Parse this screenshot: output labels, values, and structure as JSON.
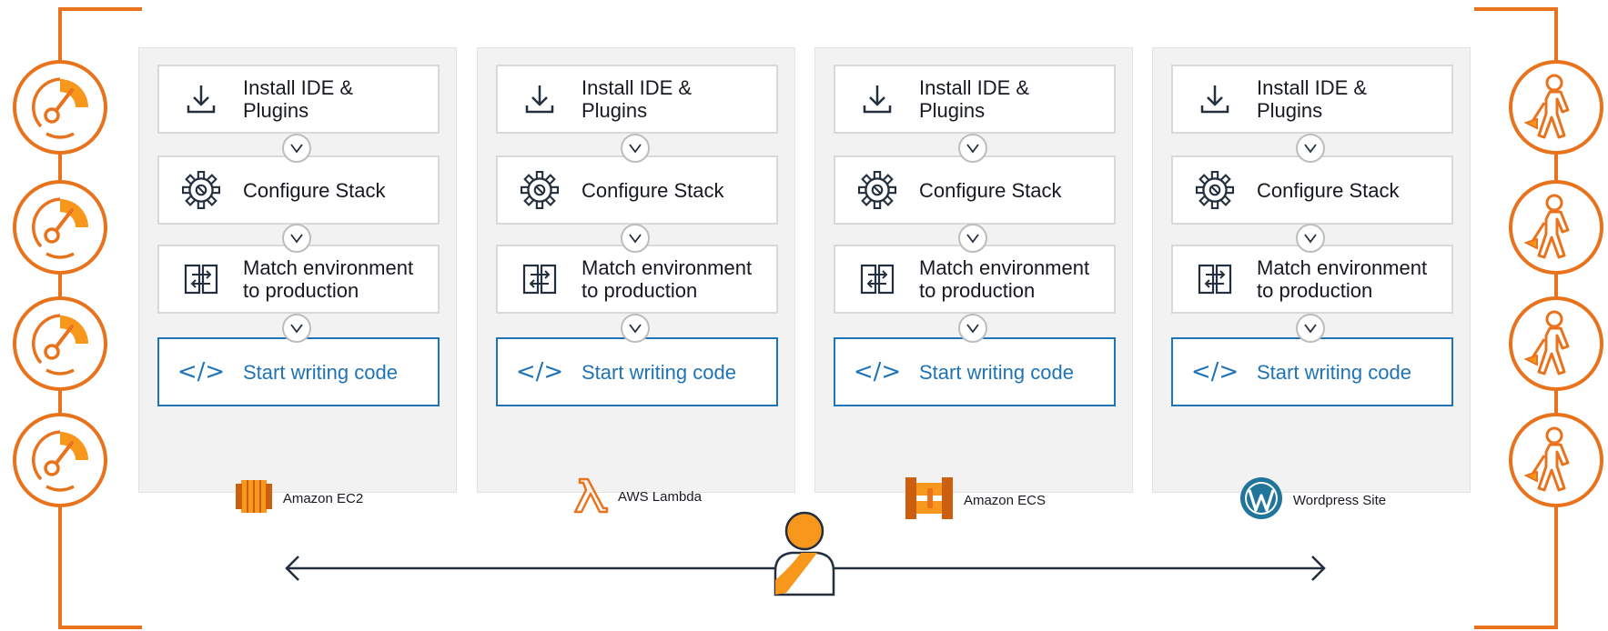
{
  "columns": [
    {
      "steps": [
        {
          "label_lines": [
            "Install IDE &",
            "Plugins"
          ]
        },
        {
          "label_lines": [
            "Configure Stack"
          ]
        },
        {
          "label_lines": [
            "Match environment",
            "to production"
          ]
        },
        {
          "label_lines": [
            "Start writing code"
          ]
        }
      ],
      "service": {
        "label": "Amazon EC2",
        "icon": "amazon-ec2-icon"
      }
    },
    {
      "steps": [
        {
          "label_lines": [
            "Install IDE &",
            "Plugins"
          ]
        },
        {
          "label_lines": [
            "Configure Stack"
          ]
        },
        {
          "label_lines": [
            "Match environment",
            "to production"
          ]
        },
        {
          "label_lines": [
            "Start writing code"
          ]
        }
      ],
      "service": {
        "label": "AWS Lambda",
        "icon": "aws-lambda-icon"
      }
    },
    {
      "steps": [
        {
          "label_lines": [
            "Install IDE &",
            "Plugins"
          ]
        },
        {
          "label_lines": [
            "Configure Stack"
          ]
        },
        {
          "label_lines": [
            "Match environment",
            "to production"
          ]
        },
        {
          "label_lines": [
            "Start writing code"
          ]
        }
      ],
      "service": {
        "label": "Amazon ECS",
        "icon": "amazon-ecs-icon"
      }
    },
    {
      "steps": [
        {
          "label_lines": [
            "Install IDE &",
            "Plugins"
          ]
        },
        {
          "label_lines": [
            "Configure Stack"
          ]
        },
        {
          "label_lines": [
            "Match environment",
            "to production"
          ]
        },
        {
          "label_lines": [
            "Start writing code"
          ]
        }
      ],
      "service": {
        "label": "Wordpress Site",
        "icon": "wordpress-icon"
      }
    }
  ],
  "step_icons": [
    "download-icon",
    "gear-icon",
    "compare-icon",
    "code-icon"
  ],
  "code_glyph": "</>",
  "left_icons": [
    "speedometer-icon",
    "speedometer-icon",
    "speedometer-icon",
    "speedometer-icon"
  ],
  "right_icons": [
    "construction-worker-icon",
    "construction-worker-icon",
    "construction-worker-icon",
    "construction-worker-icon"
  ],
  "center_icon": "developer-person-icon",
  "colors": {
    "accent": "#e8731c",
    "link_blue": "#1f73b7",
    "panel": "#f2f2f2",
    "wordpress_blue": "#21759b"
  }
}
